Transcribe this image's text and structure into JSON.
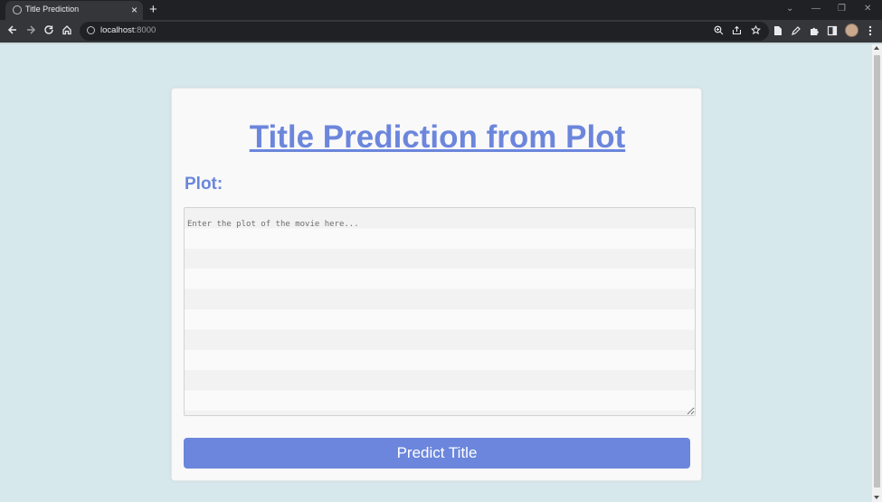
{
  "browser": {
    "tab_title": "Title Prediction",
    "tab_close": "×",
    "new_tab": "+",
    "url_host": "localhost",
    "url_port": ":8000",
    "window_controls": [
      "⌄",
      "—",
      "❐",
      "✕"
    ]
  },
  "page": {
    "title": "Title Prediction from Plot",
    "plot_label": "Plot:",
    "plot_placeholder": "Enter the plot of the movie here...",
    "plot_value": "",
    "predict_button": "Predict Title"
  },
  "colors": {
    "accent": "#6b86dc",
    "page_background": "#d7e8ec",
    "card_background": "#f9f9f9"
  },
  "icons": {
    "back": "back-arrow-icon",
    "forward": "forward-arrow-icon",
    "reload": "reload-icon",
    "home": "home-icon",
    "site_info": "info-icon",
    "zoom": "zoom-icon",
    "share": "share-icon",
    "bookmark": "star-icon",
    "extensions": [
      "document-icon",
      "pen-icon",
      "puzzle-icon",
      "side-panel-icon"
    ],
    "menu": "kebab-menu-icon"
  }
}
